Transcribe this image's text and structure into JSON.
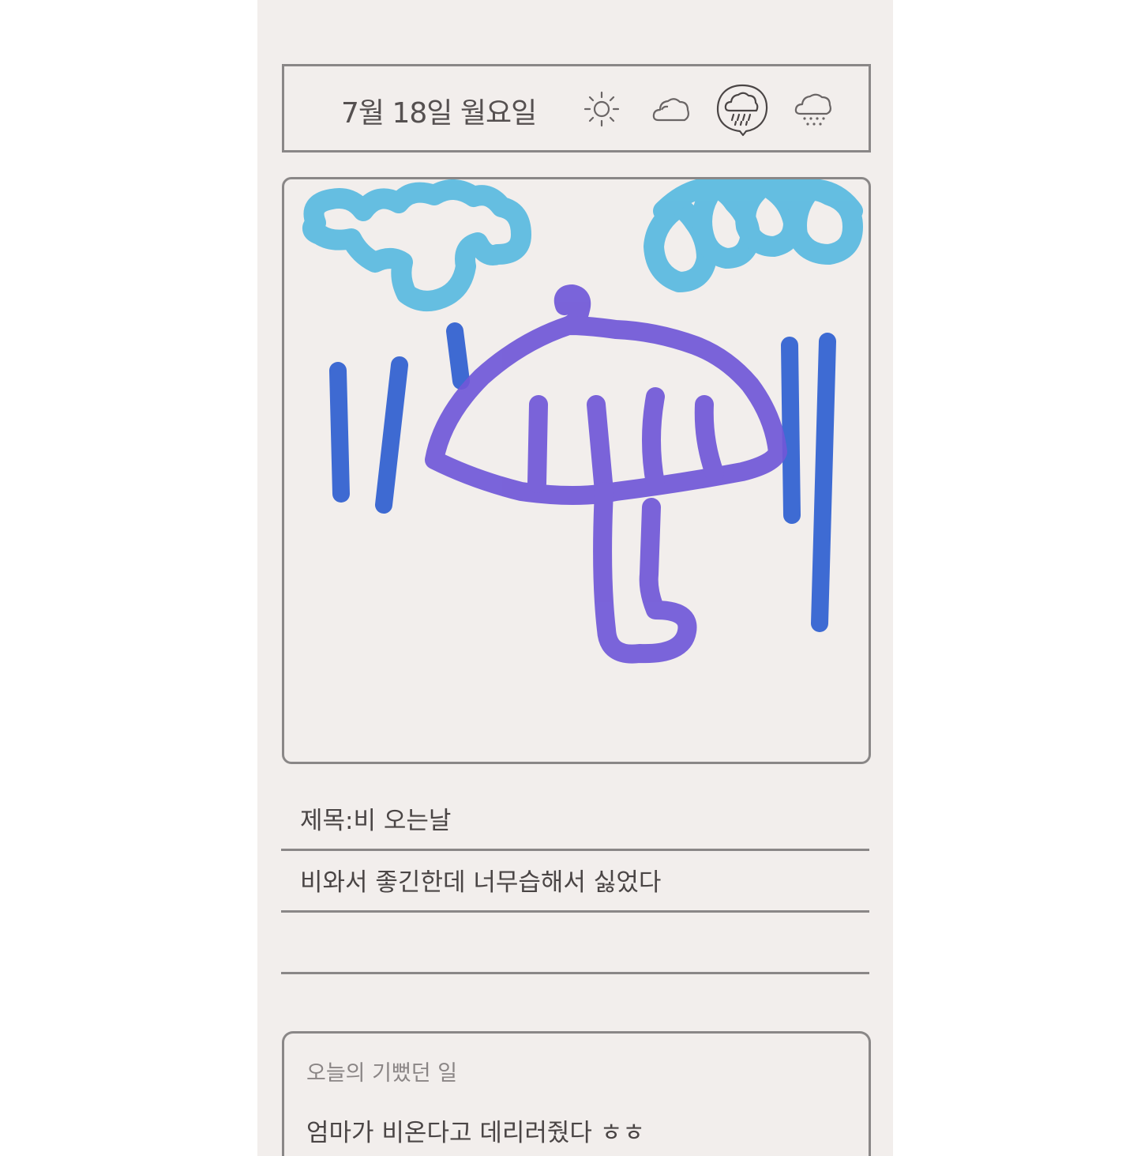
{
  "header": {
    "date": "7월 18일 월요일",
    "weather_options": [
      {
        "icon": "sun-icon",
        "selected": false
      },
      {
        "icon": "cloud-icon",
        "selected": false
      },
      {
        "icon": "rain-cloud-icon",
        "selected": true
      },
      {
        "icon": "snow-cloud-icon",
        "selected": false
      }
    ]
  },
  "drawing": {
    "subject": "umbrella-in-rain",
    "colors": {
      "cloud": "#55b8e0",
      "rain": "#2f5fd0",
      "umbrella": "#7058d8"
    }
  },
  "diary": {
    "title": "제목:비 오는날",
    "lines": [
      "비와서 좋긴한데 너무습해서 싫었다",
      ""
    ]
  },
  "happy_section": {
    "heading": "오늘의 기뻤던 일",
    "entry": "엄마가 비온다고 데리러줬다 ㅎㅎ"
  }
}
